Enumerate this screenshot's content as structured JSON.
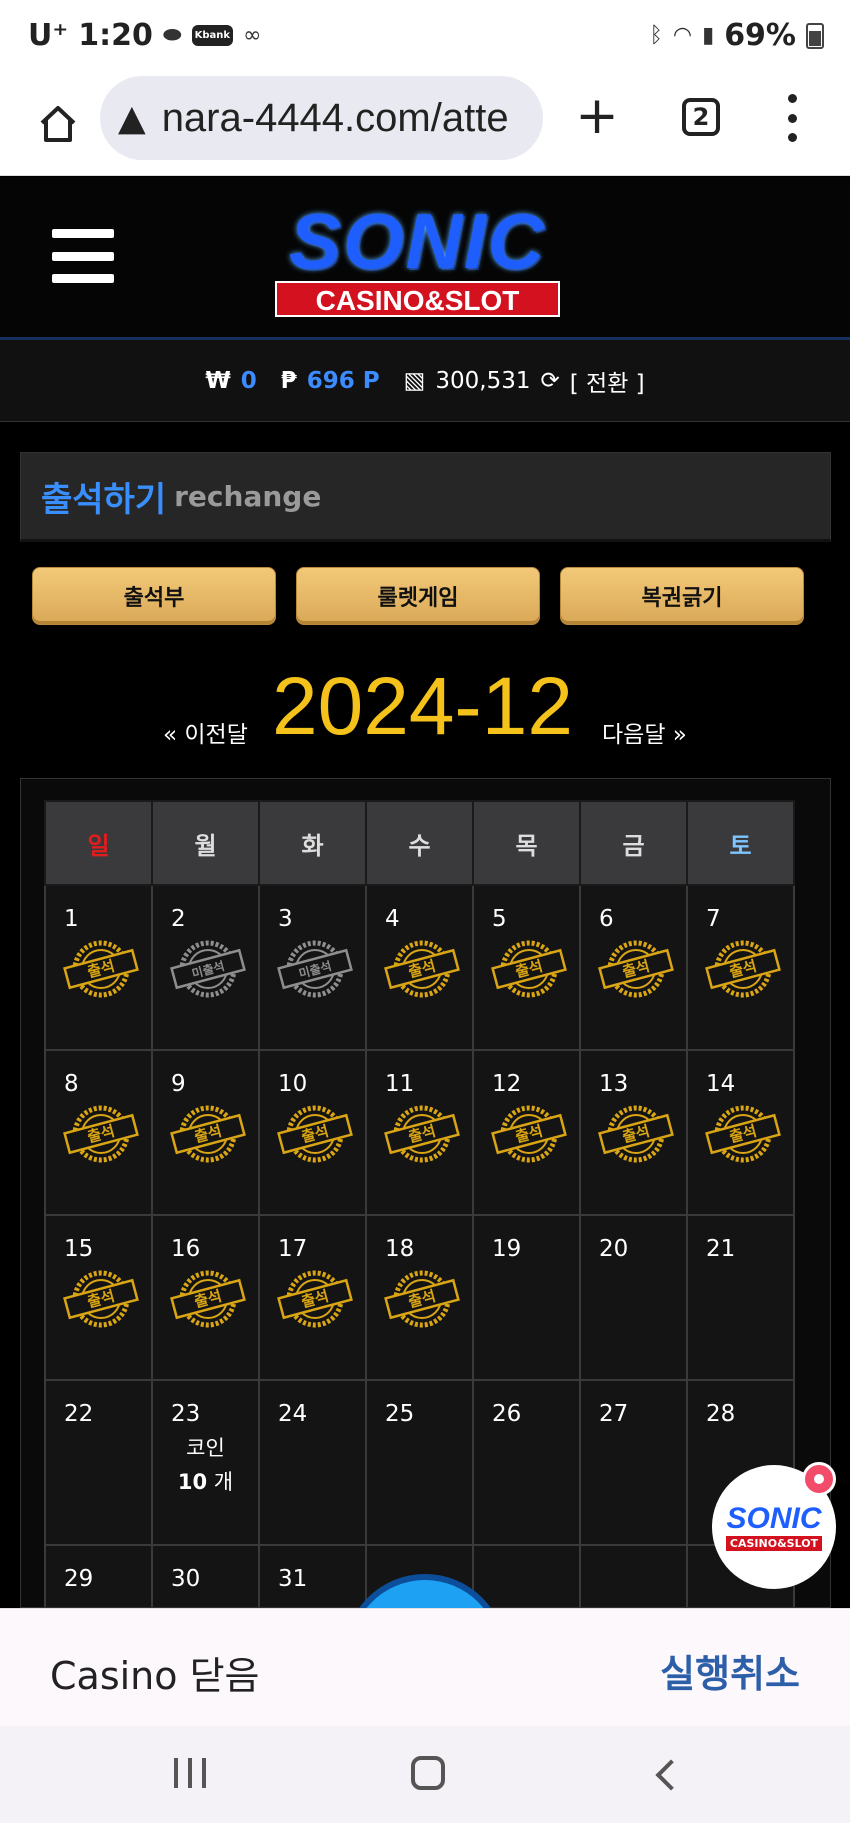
{
  "status_bar": {
    "carrier": "U⁺",
    "time": "1:20",
    "kbank_label": "Kbank",
    "battery": "69%"
  },
  "browser": {
    "url": "nara-4444.com/atte",
    "tab_count": "2"
  },
  "header": {
    "logo_main": "SONIC",
    "logo_sub": "CASINO&SLOT"
  },
  "balance": {
    "won_symbol": "₩",
    "won": "0",
    "point_symbol": "₱",
    "points": "696 P",
    "chips": "300,531",
    "convert_label": "[ 전환 ]"
  },
  "page": {
    "title": "출석하기",
    "subtitle": "rechange"
  },
  "buttons": {
    "attendance": "출석부",
    "roulette": "룰렛게임",
    "lottery": "복권긁기"
  },
  "month_nav": {
    "prev": "« 이전달",
    "month": "2024-12",
    "next": "다음달 »"
  },
  "calendar": {
    "weekdays": [
      "일",
      "월",
      "화",
      "수",
      "목",
      "금",
      "토"
    ],
    "stamp_attended": "출석",
    "stamp_missed": "미출석",
    "coin_label": "코인",
    "coin_amount": "10",
    "coin_unit": "개",
    "days": [
      {
        "d": "1",
        "s": "attended"
      },
      {
        "d": "2",
        "s": "missed"
      },
      {
        "d": "3",
        "s": "missed"
      },
      {
        "d": "4",
        "s": "attended"
      },
      {
        "d": "5",
        "s": "attended"
      },
      {
        "d": "6",
        "s": "attended"
      },
      {
        "d": "7",
        "s": "attended"
      },
      {
        "d": "8",
        "s": "attended"
      },
      {
        "d": "9",
        "s": "attended"
      },
      {
        "d": "10",
        "s": "attended"
      },
      {
        "d": "11",
        "s": "attended"
      },
      {
        "d": "12",
        "s": "attended"
      },
      {
        "d": "13",
        "s": "attended"
      },
      {
        "d": "14",
        "s": "attended"
      },
      {
        "d": "15",
        "s": "attended"
      },
      {
        "d": "16",
        "s": "attended"
      },
      {
        "d": "17",
        "s": "attended"
      },
      {
        "d": "18",
        "s": "attended"
      },
      {
        "d": "19",
        "s": ""
      },
      {
        "d": "20",
        "s": ""
      },
      {
        "d": "21",
        "s": ""
      },
      {
        "d": "22",
        "s": ""
      },
      {
        "d": "23",
        "s": "coin"
      },
      {
        "d": "24",
        "s": ""
      },
      {
        "d": "25",
        "s": ""
      },
      {
        "d": "26",
        "s": ""
      },
      {
        "d": "27",
        "s": ""
      },
      {
        "d": "28",
        "s": ""
      },
      {
        "d": "29",
        "s": ""
      },
      {
        "d": "30",
        "s": ""
      },
      {
        "d": "31",
        "s": ""
      },
      {
        "d": "",
        "s": ""
      },
      {
        "d": "",
        "s": ""
      },
      {
        "d": "",
        "s": ""
      },
      {
        "d": "",
        "s": ""
      }
    ]
  },
  "float_widget": {
    "logo_main": "SONIC",
    "logo_sub": "CASINO&SLOT"
  },
  "snackbar": {
    "message": "Casino 닫음",
    "action": "실행취소"
  },
  "colors": {
    "accent_blue": "#3a8fff",
    "gold": "#f4c21b",
    "button_gold": "#e3b868"
  }
}
